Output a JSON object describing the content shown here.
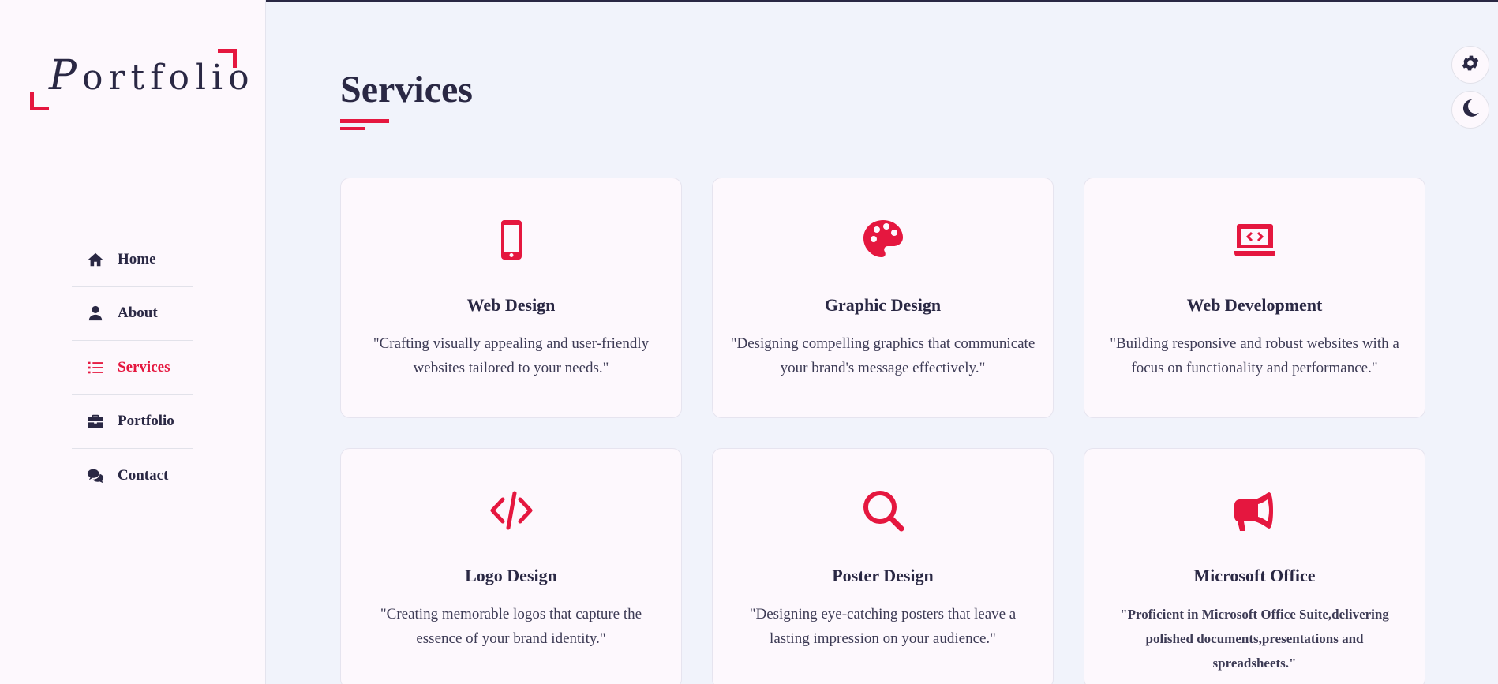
{
  "colors": {
    "accent": "#e5173f",
    "text": "#2a2844",
    "background": "#f1f3fb",
    "card": "#fdf8fd"
  },
  "logo": {
    "first_letter": "P",
    "rest": "ortfolio"
  },
  "nav": {
    "items": [
      {
        "label": "Home",
        "icon": "home-icon",
        "active": false
      },
      {
        "label": "About",
        "icon": "user-icon",
        "active": false
      },
      {
        "label": "Services",
        "icon": "list-icon",
        "active": true
      },
      {
        "label": "Portfolio",
        "icon": "briefcase-icon",
        "active": false
      },
      {
        "label": "Contact",
        "icon": "comments-icon",
        "active": false
      }
    ]
  },
  "page": {
    "title": "Services"
  },
  "services": [
    {
      "title": "Web Design",
      "icon": "mobile-icon",
      "description": "\"Crafting visually appealing and user-friendly websites tailored to your needs.\""
    },
    {
      "title": "Graphic Design",
      "icon": "palette-icon",
      "description": "\"Designing compelling graphics that communicate your brand's message effectively.\""
    },
    {
      "title": "Web Development",
      "icon": "laptop-code-icon",
      "description": "\"Building responsive and robust websites with a focus on functionality and performance.\""
    },
    {
      "title": "Logo Design",
      "icon": "code-icon",
      "description": "\"Creating memorable logos that capture the essence of your brand identity.\""
    },
    {
      "title": "Poster Design",
      "icon": "search-icon",
      "description": "\"Designing eye-catching posters that leave a lasting impression on your audience.\""
    },
    {
      "title": "Microsoft Office",
      "icon": "bullhorn-icon",
      "description": "\"Proficient in Microsoft Office Suite,delivering polished documents,presentations and spreadsheets.\""
    }
  ],
  "controls": {
    "settings_icon": "gear-icon",
    "theme_icon": "moon-icon"
  }
}
